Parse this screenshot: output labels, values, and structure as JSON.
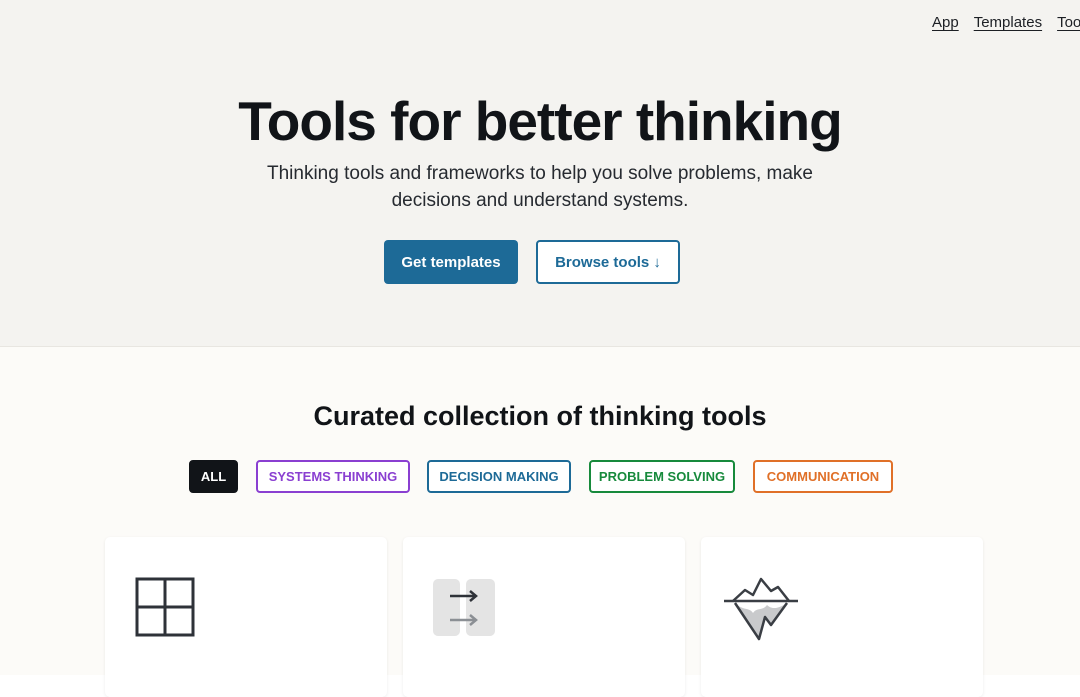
{
  "nav": {
    "items": [
      {
        "label": "App"
      },
      {
        "label": "Templates"
      },
      {
        "label": "Tools"
      }
    ]
  },
  "hero": {
    "title": "Tools for better thinking",
    "subtitle": "Thinking tools and frameworks to help you solve problems, make decisions and understand systems.",
    "primary_button": "Get templates",
    "secondary_button": "Browse tools ↓"
  },
  "collection": {
    "title": "Curated collection of thinking tools",
    "filters": [
      {
        "label": "ALL",
        "color": "#111418",
        "active": true
      },
      {
        "label": "SYSTEMS THINKING",
        "color": "#8a3fd1",
        "active": false
      },
      {
        "label": "DECISION MAKING",
        "color": "#1d6a97",
        "active": false
      },
      {
        "label": "PROBLEM SOLVING",
        "color": "#178a3c",
        "active": false
      },
      {
        "label": "COMMUNICATION",
        "color": "#e07028",
        "active": false
      }
    ],
    "cards": [
      {
        "icon": "grid-quadrant-icon"
      },
      {
        "icon": "double-arrow-compare-icon"
      },
      {
        "icon": "iceberg-icon"
      }
    ]
  },
  "colors": {
    "accent": "#1d6a97",
    "hero_bg": "#f4f3f0",
    "section_bg": "#fcfbf8"
  }
}
